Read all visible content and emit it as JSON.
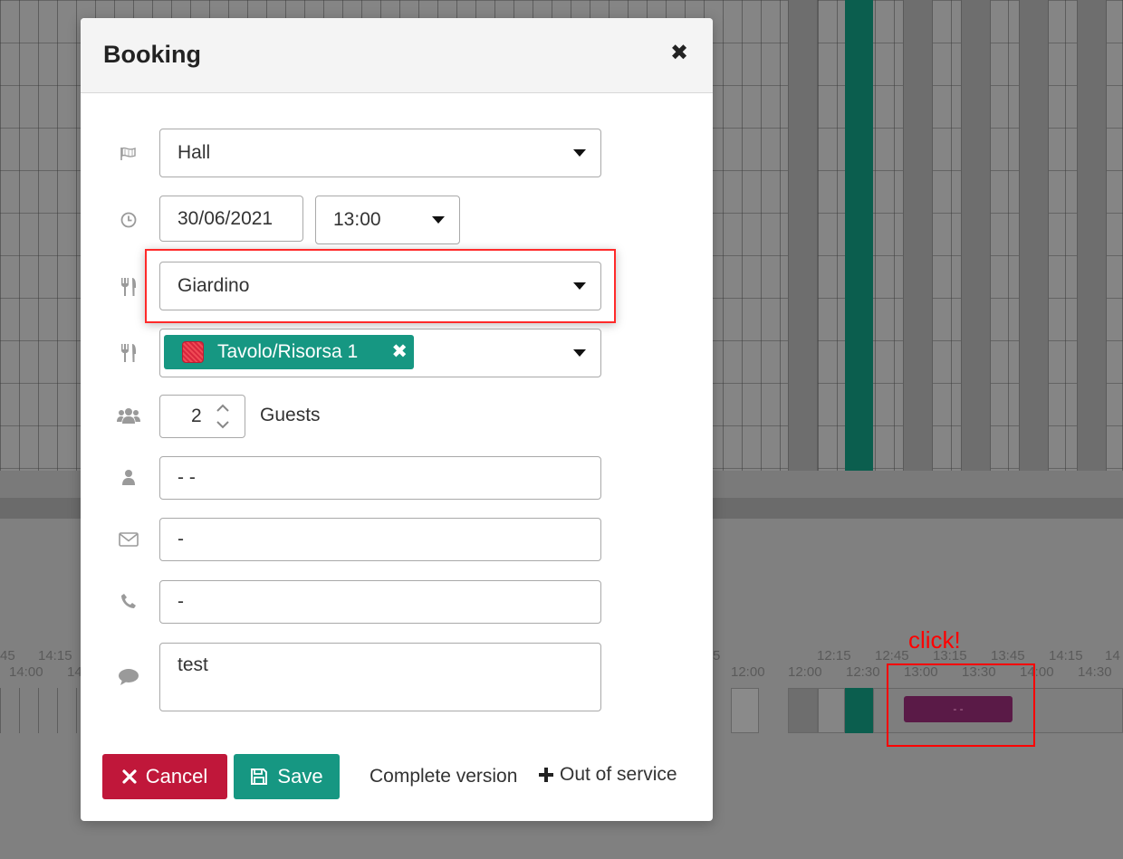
{
  "modal": {
    "title": "Booking",
    "close_icon": "close-icon"
  },
  "form": {
    "hall": {
      "icon": "flag-icon",
      "value": "Hall"
    },
    "date": {
      "icon": "clock-icon",
      "value": "30/06/2021"
    },
    "time": {
      "value": "13:00"
    },
    "area": {
      "icon": "cutlery-icon",
      "value": "Giardino"
    },
    "table": {
      "icon": "cutlery-icon",
      "tag_label": "Tavolo/Risorsa 1",
      "tag_color": "#169782"
    },
    "guests": {
      "icon": "users-icon",
      "value": "2",
      "label": "Guests"
    },
    "name": {
      "icon": "user-icon",
      "value": "- -"
    },
    "email": {
      "icon": "envelope-icon",
      "value": "-"
    },
    "phone": {
      "icon": "phone-icon",
      "value": "-"
    },
    "notes": {
      "icon": "comment-icon",
      "value": "test"
    }
  },
  "footer": {
    "cancel_label": "Cancel",
    "save_label": "Save",
    "complete_version_label": "Complete version",
    "out_of_service_label": "Out of service"
  },
  "timeline": {
    "left_labels_top": [
      "45",
      "14:15"
    ],
    "left_labels_bottom": [
      "14:00",
      "14"
    ],
    "top_labels": [
      "12:15",
      "12:45",
      "13:15",
      "13:45",
      "14:15",
      "14"
    ],
    "bottom_labels": [
      "12:00",
      "12:00",
      "12:30",
      "13:00",
      "13:30",
      "14:00",
      "14:30"
    ],
    "partial_label": "5",
    "click_label": "click!",
    "booking_chip": "- -"
  },
  "colors": {
    "accent_green": "#169782",
    "cancel_red": "#c0173a",
    "booking_purple": "#5a1a47",
    "highlight_red": "#ff2a2a"
  }
}
